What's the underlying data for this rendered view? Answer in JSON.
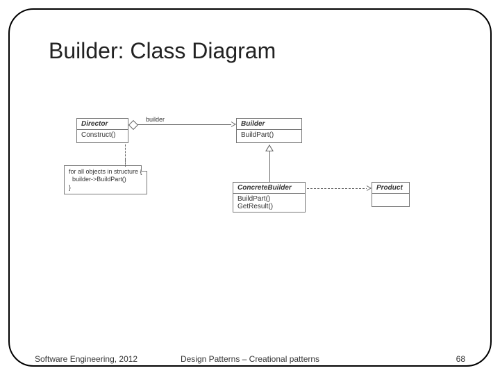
{
  "title": "Builder: Class Diagram",
  "footer": {
    "left": "Software Engineering, 2012",
    "center": "Design Patterns – Creational patterns",
    "right": "68"
  },
  "diagram": {
    "director": {
      "name": "Director",
      "ops": "Construct()"
    },
    "builder": {
      "name": "Builder",
      "ops": "BuildPart()"
    },
    "concrete": {
      "name": "ConcreteBuilder",
      "ops1": "BuildPart()",
      "ops2": "GetResult()"
    },
    "product": {
      "name": "Product"
    },
    "assoc_label": "builder",
    "note": "for all objects in structure {\n  builder->BuildPart()\n}"
  }
}
